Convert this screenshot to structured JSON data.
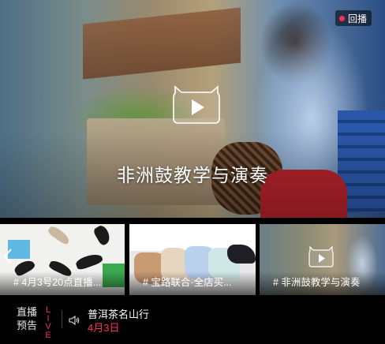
{
  "hero": {
    "badge": "回播",
    "title": "非洲鼓教学与演奏",
    "play_icon": "play-icon"
  },
  "thumbnails": [
    {
      "caption": "# 4月3号20点直播..."
    },
    {
      "caption": "# 宝路联合·全店买..."
    },
    {
      "caption": "# 非洲鼓教学与演奏"
    }
  ],
  "ticker": {
    "label_line1": "直播",
    "label_line2": "预告",
    "live_tag": "LIVE",
    "title": "普洱茶名山行",
    "date": "4月3日"
  },
  "colors": {
    "accent": "#ff2f67",
    "live": "#e8336b",
    "badge_dot": "#ff2a55"
  }
}
